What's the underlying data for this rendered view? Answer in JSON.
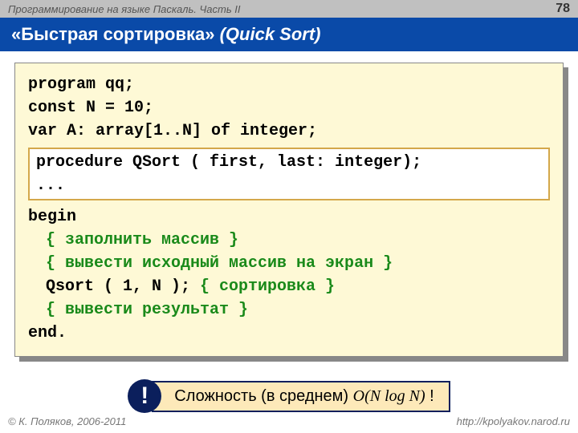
{
  "header": {
    "course": "Программирование на языке Паскаль. Часть II",
    "page": "78"
  },
  "title": {
    "main": "«Быстрая сортировка» ",
    "italic": "(Quick Sort)"
  },
  "code": {
    "l1": "program qq;",
    "l2": "const N = 10;",
    "l3": "var A: array[1..N] of integer;",
    "inset1": "procedure QSort ( first, last: integer);",
    "inset2": "...",
    "l4": "begin",
    "c1": "{ заполнить массив }",
    "c2": "{ вывести исходный массив на экран }",
    "l5a": "Qsort ( 1, N ); ",
    "l5b": "{ сортировка }",
    "c3": "{ вывести результат }",
    "l6": "end."
  },
  "complexity": {
    "excl": "!",
    "label_pre": "Сложность (в среднем) ",
    "formula": "O(N log N)",
    "label_post": " !"
  },
  "footer": {
    "copyright": "© К. Поляков, 2006-2011",
    "url": "http://kpolyakov.narod.ru"
  }
}
